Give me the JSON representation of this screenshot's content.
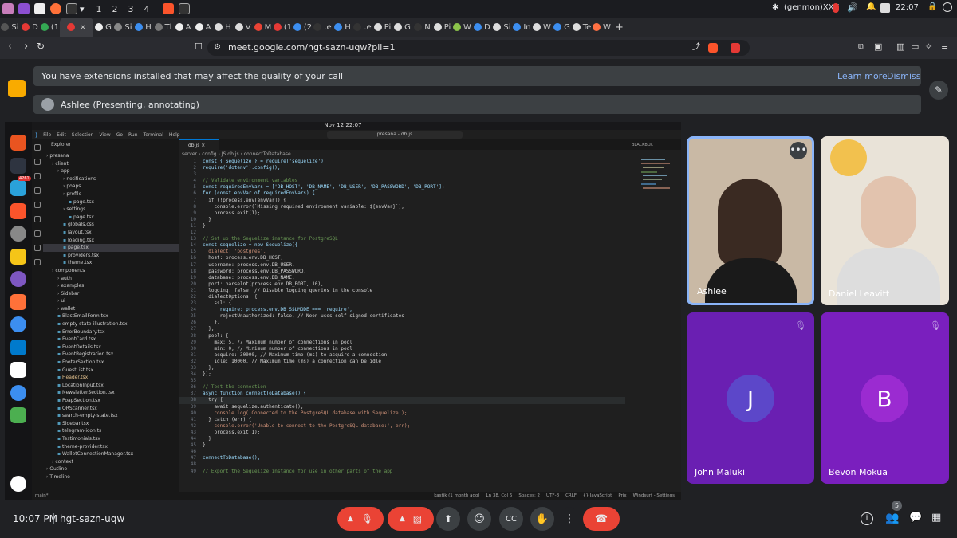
{
  "taskbar": {
    "workspaces": [
      "1",
      "2",
      "3",
      "4"
    ],
    "status_text": "(genmon)XXX",
    "time": "22:07"
  },
  "browser": {
    "tabs": [
      {
        "label": "Si"
      },
      {
        "label": "D"
      },
      {
        "label": "(1"
      },
      {
        "label": ""
      },
      {
        "label": "G"
      },
      {
        "label": "Si"
      },
      {
        "label": "H"
      },
      {
        "label": "Tl"
      },
      {
        "label": "A"
      },
      {
        "label": "A"
      },
      {
        "label": "H"
      },
      {
        "label": "V"
      },
      {
        "label": "M"
      },
      {
        "label": "(1"
      },
      {
        "label": "(2"
      },
      {
        "label": ".e"
      },
      {
        "label": "H"
      },
      {
        "label": ".e"
      },
      {
        "label": "Pi"
      },
      {
        "label": "G"
      },
      {
        "label": "N"
      },
      {
        "label": "Pi"
      },
      {
        "label": "W"
      },
      {
        "label": "D"
      },
      {
        "label": "Si"
      },
      {
        "label": "In"
      },
      {
        "label": "W"
      },
      {
        "label": "G"
      },
      {
        "label": "Te"
      },
      {
        "label": "W"
      }
    ],
    "url": "meet.google.com/hgt-sazn-uqw?pli=1"
  },
  "meet": {
    "banner": {
      "text": "You have extensions installed that may affect the quality of your call",
      "learn_more": "Learn more",
      "dismiss": "Dismiss"
    },
    "presenting": "Ashlee (Presenting, annotating)",
    "time": "10:07 PM",
    "separator": "|",
    "meeting_code": "hgt-sazn-uqw",
    "people_count": "5",
    "participants": [
      {
        "name": "Ashlee"
      },
      {
        "name": "Daniel Leavitt"
      },
      {
        "name": "John Maluki",
        "initial": "J"
      },
      {
        "name": "Bevon Mokua",
        "initial": "B"
      }
    ]
  },
  "shared_screen": {
    "os_bar_time": "Nov 12 22:07",
    "dock_badge": "4261",
    "vscode": {
      "menu": [
        "File",
        "Edit",
        "Selection",
        "View",
        "Go",
        "Run",
        "Terminal",
        "Help"
      ],
      "search": "presana - db.js",
      "explorer_title": "Explorer",
      "tree": [
        "presana",
        "client",
        "app",
        "notifications",
        "poaps",
        "profile",
        "page.tsx",
        "settings",
        "page.tsx",
        "globals.css",
        "layout.tsx",
        "loading.tsx",
        "page.tsx",
        "providers.tsx",
        "theme.tsx",
        "components",
        "auth",
        "examples",
        "Sidebar",
        "ui",
        "wallet",
        "BlastEmailForm.tsx",
        "empty-state-illustration.tsx",
        "ErrorBoundary.tsx",
        "EventCard.tsx",
        "EventDetails.tsx",
        "EventRegistration.tsx",
        "FooterSection.tsx",
        "GuestList.tsx",
        "Header.tsx",
        "LocationInput.tsx",
        "NewsletterSection.tsx",
        "PoapSection.tsx",
        "QRScanner.tsx",
        "search-empty-state.tsx",
        "Sidebar.tsx",
        "telegram-icon.ts",
        "Testimonials.tsx",
        "theme-provider.tsx",
        "WalletConnectionManager.tsx",
        "context",
        "Outline",
        "Timeline"
      ],
      "tab": "db.js",
      "breadcrumb": "server › config › JS db.js › connectToDatabase",
      "blackbox": "BLACKBOX",
      "code": [
        "const { Sequelize } = require('sequelize');",
        "require('dotenv').config();",
        "",
        "// Validate environment variables",
        "const requiredEnvVars = ['DB_HOST', 'DB_NAME', 'DB_USER', 'DB_PASSWORD', 'DB_PORT'];",
        "for (const envVar of requiredEnvVars) {",
        "  if (!process.env[envVar]) {",
        "    console.error(`Missing required environment variable: ${envVar}`);",
        "    process.exit(1);",
        "  }",
        "}",
        "",
        "// Set up the Sequelize instance for PostgreSQL",
        "const sequelize = new Sequelize({",
        "  dialect: 'postgres',",
        "  host: process.env.DB_HOST,",
        "  username: process.env.DB_USER,",
        "  password: process.env.DB_PASSWORD,",
        "  database: process.env.DB_NAME,",
        "  port: parseInt(process.env.DB_PORT, 10),",
        "  logging: false, // Disable logging queries in the console",
        "  dialectOptions: {",
        "    ssl: {",
        "      require: process.env.DB_SSLMODE === 'require',",
        "      rejectUnauthorized: false, // Neon uses self-signed certificates",
        "    },",
        "  },",
        "  pool: {",
        "    max: 5, // Maximum number of connections in pool",
        "    min: 0, // Minimum number of connections in pool",
        "    acquire: 30000, // Maximum time (ms) to acquire a connection",
        "    idle: 10000, // Maximum time (ms) a connection can be idle",
        "  },",
        "});",
        "",
        "// Test the connection",
        "async function connectToDatabase() {",
        "  try {",
        "    await sequelize.authenticate();",
        "    console.log('Connected to the PostgreSQL database with Sequelize');",
        "  } catch (err) {",
        "    console.error('Unable to connect to the PostgreSQL database:', err);",
        "    process.exit(1);",
        "  }",
        "}",
        "",
        "connectToDatabase();",
        "",
        "// Export the Sequelize instance for use in other parts of the app"
      ],
      "status_left": "main*",
      "status_right": [
        "kastik (1 month ago)",
        "Ln 38, Col 6",
        "Spaces: 2",
        "UTF-8",
        "CRLF",
        "{} JavaScript",
        "Prix",
        "Windsurf - Settings"
      ]
    }
  }
}
